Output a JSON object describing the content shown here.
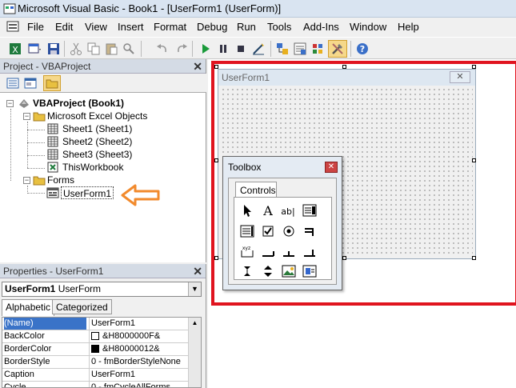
{
  "window": {
    "title": "Microsoft Visual Basic - Book1 - [UserForm1 (UserForm)]"
  },
  "menu": [
    "File",
    "Edit",
    "View",
    "Insert",
    "Format",
    "Debug",
    "Run",
    "Tools",
    "Add-Ins",
    "Window",
    "Help"
  ],
  "project": {
    "title": "Project - VBAProject",
    "root": "VBAProject (Book1)",
    "excel_objects": "Microsoft Excel Objects",
    "sheets": [
      "Sheet1 (Sheet1)",
      "Sheet2 (Sheet2)",
      "Sheet3 (Sheet3)"
    ],
    "workbook": "ThisWorkbook",
    "forms": "Forms",
    "userform": "UserForm1"
  },
  "properties": {
    "title": "Properties - UserForm1",
    "object_name": "UserForm1",
    "object_type": "UserForm",
    "tabs": [
      "Alphabetic",
      "Categorized"
    ],
    "rows": [
      {
        "name": "(Name)",
        "value": "UserForm1"
      },
      {
        "name": "BackColor",
        "value": "&H8000000F&"
      },
      {
        "name": "BorderColor",
        "value": "&H80000012&"
      },
      {
        "name": "BorderStyle",
        "value": "0 - fmBorderStyleNone"
      },
      {
        "name": "Caption",
        "value": "UserForm1"
      },
      {
        "name": "Cycle",
        "value": "0 - fmCycleAllForms"
      }
    ]
  },
  "userform": {
    "title": "UserForm1"
  },
  "toolbox": {
    "title": "Toolbox",
    "tab": "Controls"
  },
  "colors": {
    "highlight": "#e0141f",
    "annotation_arrow": "#f28a2c"
  }
}
